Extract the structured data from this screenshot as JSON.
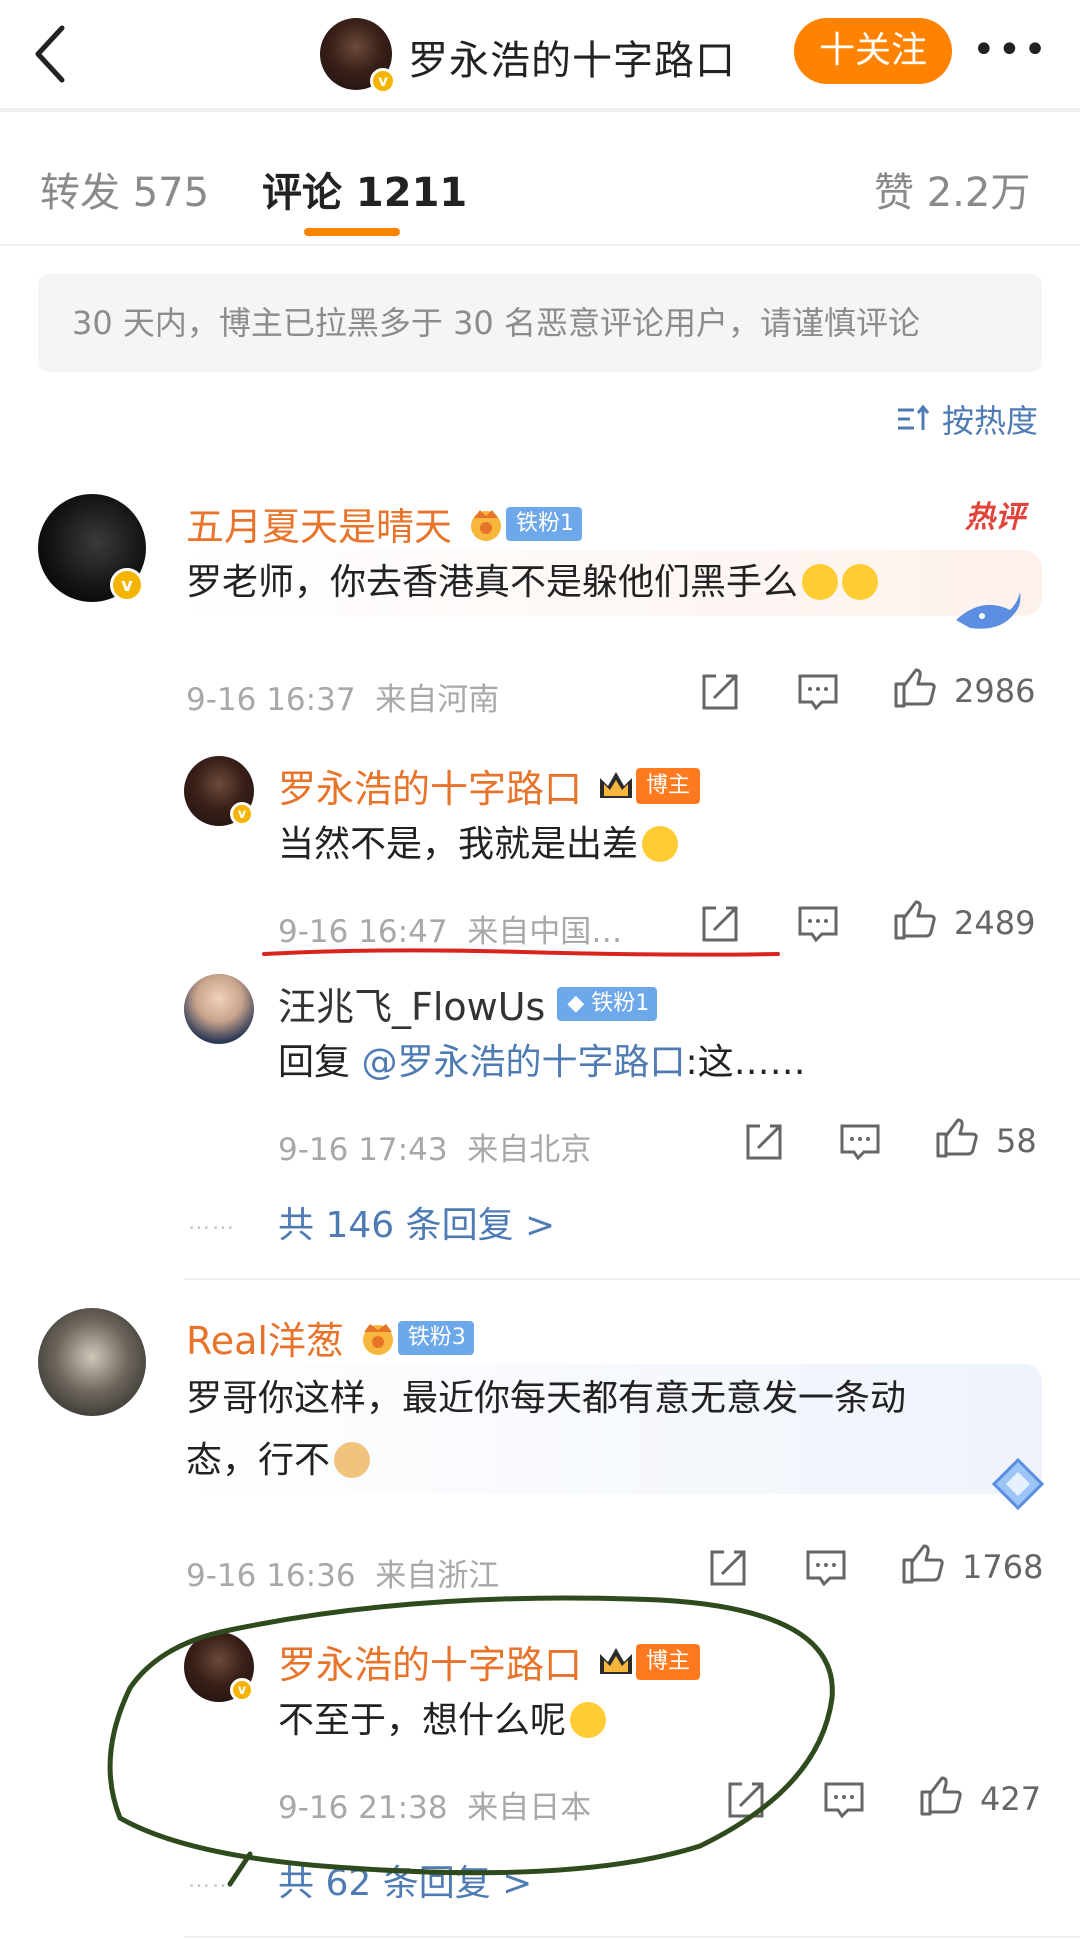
{
  "header": {
    "title": "罗永浩的十字路口",
    "follow_label": "十关注",
    "more_icon": "more-icon"
  },
  "tabs": {
    "repost": "转发 575",
    "comments": "评论 1211",
    "likes": "赞 2.2万"
  },
  "notice": "30 天内，博主已拉黑多于 30 名恶意评论用户，请谨慎评论",
  "sort_label": "按热度",
  "comments": [
    {
      "user": "五月夏天是晴天",
      "fan_badge": "铁粉1",
      "hot_tag": "热评",
      "text": "罗老师，你去香港真不是躲他们黑手么",
      "time": "9-16 16:37",
      "location": "来自河南",
      "likes": "2986",
      "replies": [
        {
          "user": "罗永浩的十字路口",
          "role_badge": "博主",
          "text": "当然不是，我就是出差",
          "time": "9-16 16:47",
          "location": "来自中国…",
          "likes": "2489"
        },
        {
          "user": "汪兆飞_FlowUs",
          "fan_badge": "铁粉1",
          "reply_prefix": "回复",
          "mention": "@罗永浩的十字路口",
          "text": ":这……",
          "time": "9-16 17:43",
          "location": "来自北京",
          "likes": "58"
        }
      ],
      "more_replies": "共 146 条回复 >"
    },
    {
      "user": "Real洋葱",
      "fan_badge": "铁粉3",
      "text_line1": "罗哥你这样，最近你每天都有意无意发一条动",
      "text_line2": "态，行不",
      "time": "9-16 16:36",
      "location": "来自浙江",
      "likes": "1768",
      "replies": [
        {
          "user": "罗永浩的十字路口",
          "role_badge": "博主",
          "text": "不至于，想什么呢",
          "time": "9-16 21:38",
          "location": "来自日本",
          "likes": "427"
        }
      ],
      "more_replies": "共 62 条回复 >"
    }
  ],
  "colors": {
    "accent": "#ff8200",
    "link": "#4f7bb4",
    "username": "#e8742c",
    "annotation_red": "#d8241c",
    "annotation_green": "#2f4a1c"
  }
}
